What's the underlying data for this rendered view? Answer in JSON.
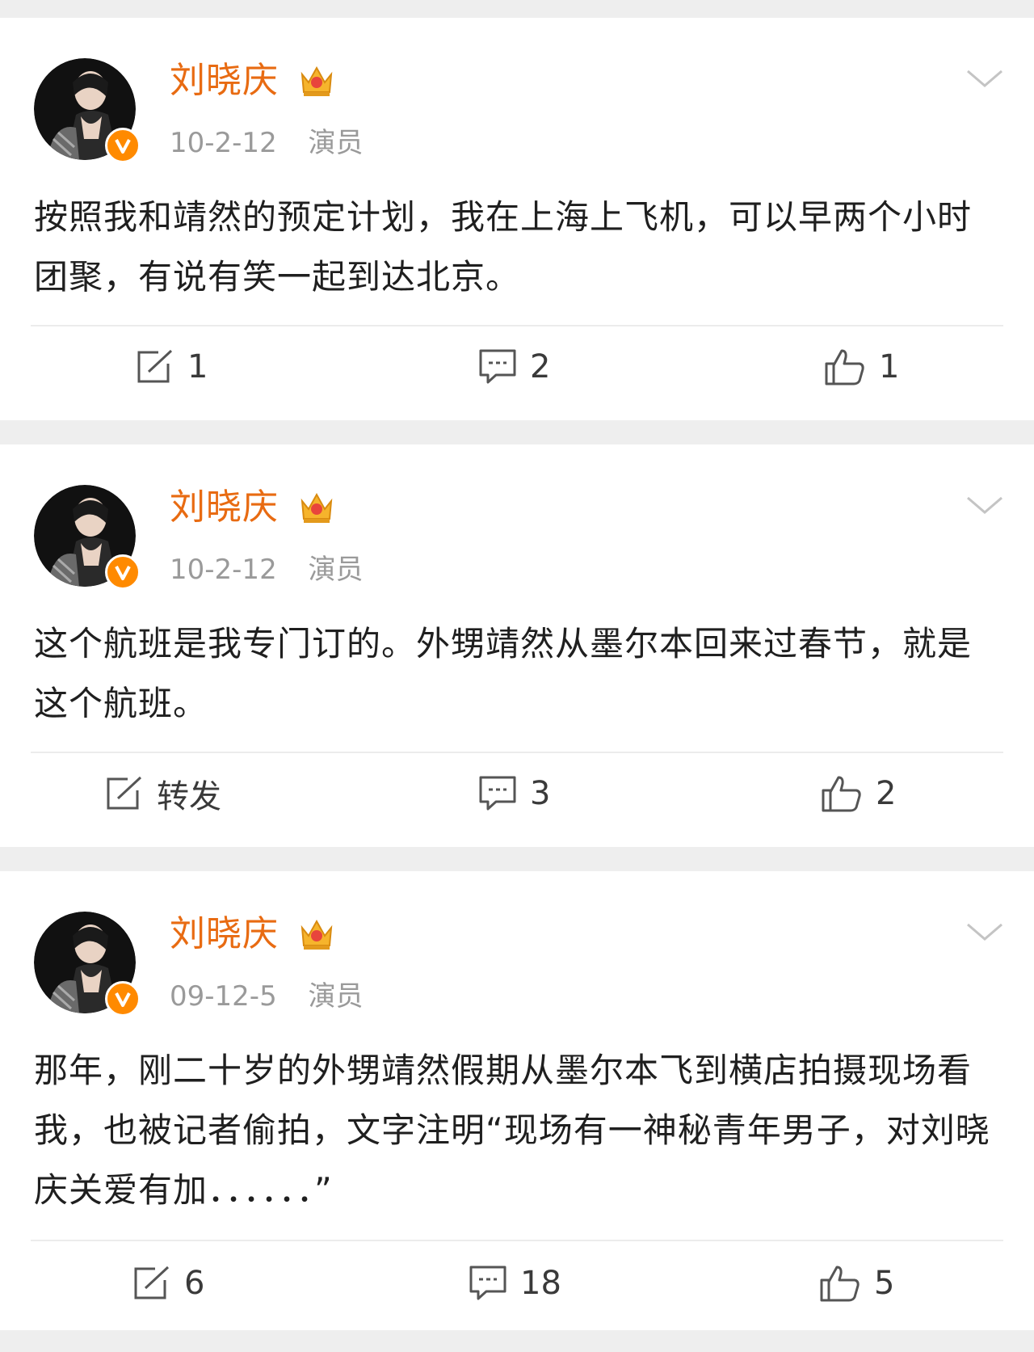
{
  "posts": [
    {
      "username": "刘晓庆",
      "date": "10-2-12",
      "tag": "演员",
      "text": "按照我和靖然的预定计划，我在上海上飞机，可以早两个小时团聚，有说有笑一起到达北京。",
      "repost": "1",
      "comments": "2",
      "likes": "1"
    },
    {
      "username": "刘晓庆",
      "date": "10-2-12",
      "tag": "演员",
      "text": "这个航班是我专门订的。外甥靖然从墨尔本回来过春节，就是这个航班。",
      "repost": "转发",
      "comments": "3",
      "likes": "2"
    },
    {
      "username": "刘晓庆",
      "date": "09-12-5",
      "tag": "演员",
      "text": "那年，刚二十岁的外甥靖然假期从墨尔本飞到横店拍摄现场看我，也被记者偷拍，文字注明“现场有一神秘青年男子，对刘晓庆关爱有加．．．．．．”",
      "repost": "6",
      "comments": "18",
      "likes": "5"
    }
  ],
  "icons": {
    "repost": "repost-icon",
    "comment": "comment-icon",
    "like": "thumbs-up-icon",
    "more": "chevron-down-icon",
    "crown": "crown-vip-icon",
    "verified": "verified-v-icon"
  },
  "colors": {
    "username": "#e86b12",
    "badge": "#ff8a00",
    "meta": "#9a9a9a",
    "background": "#eeeeee"
  }
}
